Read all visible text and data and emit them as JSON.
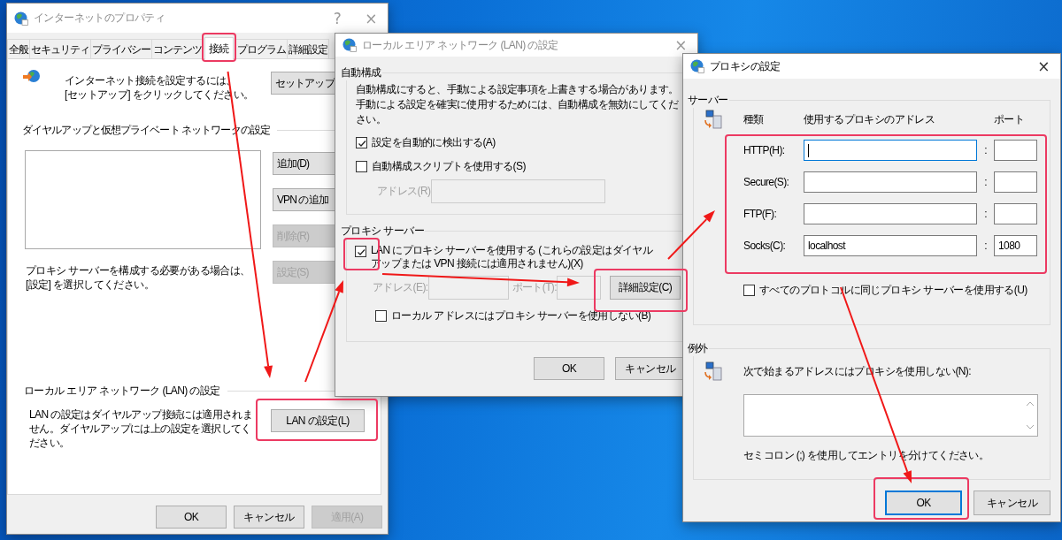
{
  "internet_properties": {
    "title": "インターネットのプロパティ",
    "active": false,
    "help": "?",
    "close": "×",
    "tabs": [
      {
        "label": "全般",
        "selected": false
      },
      {
        "label": "セキュリティ",
        "selected": false
      },
      {
        "label": "プライバシー",
        "selected": false
      },
      {
        "label": "コンテンツ",
        "selected": false
      },
      {
        "label": "接続",
        "selected": true
      },
      {
        "label": "プログラム",
        "selected": false
      },
      {
        "label": "詳細設定",
        "selected": false
      }
    ],
    "setup_text": "インターネット接続を設定するには、\n[セットアップ] をクリックしてください。",
    "setup_button": "セットアップ",
    "dialup_heading": "ダイヤルアップと仮想プライベート ネットワークの設定",
    "dialup_buttons": [
      {
        "label": "追加(D)",
        "disabled": false
      },
      {
        "label": "VPN の追加",
        "disabled": false
      },
      {
        "label": "削除(R)",
        "disabled": true
      },
      {
        "label": "設定(S)",
        "disabled": true
      }
    ],
    "proxy_note": "プロキシ サーバーを構成する必要がある場合は、\n[設定] を選択してください。",
    "lan_heading": "ローカル エリア ネットワーク (LAN) の設定",
    "lan_note": "LAN の設定はダイヤルアップ接続には適用されません。ダイヤルアップには上の設定を選択してください。",
    "lan_button": "LAN の設定(L)",
    "buttons": [
      {
        "label": "OK",
        "disabled": false
      },
      {
        "label": "キャンセル",
        "disabled": false
      },
      {
        "label": "適用(A)",
        "disabled": true
      }
    ]
  },
  "lan_settings": {
    "title": "ローカル エリア ネットワーク (LAN) の設定",
    "active": false,
    "close": "×",
    "auto_config": {
      "heading": "自動構成",
      "description": "自動構成にすると、手動による設定事項を上書きする場合があります。手動による設定を確実に使用するためには、自動構成を無効にしてください。",
      "options": [
        {
          "label": "設定を自動的に検出する(A)",
          "checked": true
        },
        {
          "label": "自動構成スクリプトを使用する(S)",
          "checked": false
        }
      ],
      "address_label": "アドレス(R):",
      "address_disabled": true
    },
    "proxy_server": {
      "heading": "プロキシ サーバー",
      "use_proxy": {
        "label": "LAN にプロキシ サーバーを使用する (これらの設定はダイヤルアップまたは VPN 接続には適用されません)(X)",
        "checked": true
      },
      "address_label": "アドレス(E):",
      "port_label": "ポート(T):",
      "fields_disabled": true,
      "advanced_button": "詳細設定(C)",
      "bypass_local": {
        "label": "ローカル アドレスにはプロキシ サーバーを使用しない(B)",
        "checked": false
      }
    },
    "buttons": [
      {
        "label": "OK"
      },
      {
        "label": "キャンセル"
      }
    ]
  },
  "proxy_settings": {
    "title": "プロキシの設定",
    "active": true,
    "close": "×",
    "servers": {
      "heading": "サーバー",
      "columns": [
        "種類",
        "使用するプロキシのアドレス",
        "ポート"
      ],
      "rows": [
        {
          "type": "HTTP(H):",
          "separator": ":",
          "focused": true
        },
        {
          "type": "Secure(S):",
          "separator": ":",
          "focused": false
        },
        {
          "type": "FTP(F):",
          "separator": ":",
          "focused": false
        },
        {
          "type": "Socks(C):",
          "address": "localhost",
          "separator": ":",
          "port": "1080",
          "focused": false
        }
      ]
    },
    "same_for_all": {
      "label": "すべてのプロトコルに同じプロキシ サーバーを使用する(U)",
      "checked": false
    },
    "exceptions": {
      "heading": "例外",
      "label": "次で始まるアドレスにはプロキシを使用しない(N):",
      "note": "セミコロン (;) を使用してエントリを分けてください。"
    },
    "buttons": [
      {
        "label": "OK",
        "default": true
      },
      {
        "label": "キャンセル",
        "default": false
      }
    ]
  }
}
